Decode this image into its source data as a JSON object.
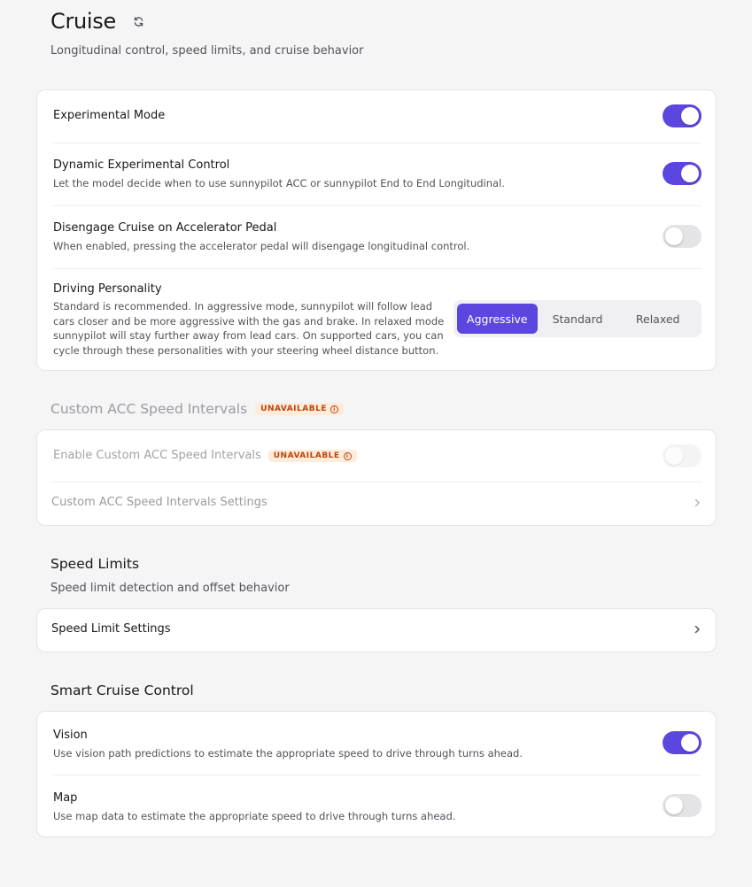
{
  "header": {
    "title": "Cruise",
    "subtitle": "Longitudinal control, speed limits, and cruise behavior"
  },
  "cruise": {
    "experimental": {
      "title": "Experimental Mode",
      "enabled": true
    },
    "dynamic": {
      "title": "Dynamic Experimental Control",
      "desc": "Let the model decide when to use sunnypilot ACC or sunnypilot End to End Longitudinal.",
      "enabled": true
    },
    "disengage": {
      "title": "Disengage Cruise on Accelerator Pedal",
      "desc": "When enabled, pressing the accelerator pedal will disengage longitudinal control.",
      "enabled": false
    },
    "personality": {
      "title": "Driving Personality",
      "desc": "Standard is recommended. In aggressive mode, sunnypilot will follow lead cars closer and be more aggressive with the gas and brake. In relaxed mode sunnypilot will stay further away from lead cars. On supported cars, you can cycle through these personalities with your steering wheel distance button.",
      "options": [
        "Aggressive",
        "Standard",
        "Relaxed"
      ],
      "selected": "Aggressive"
    }
  },
  "custom_acc": {
    "title": "Custom ACC Speed Intervals",
    "badge": "UNAVAILABLE",
    "enable": {
      "title": "Enable Custom ACC Speed Intervals",
      "badge": "UNAVAILABLE",
      "enabled": false
    },
    "settings_label": "Custom ACC Speed Intervals Settings"
  },
  "speed_limits": {
    "title": "Speed Limits",
    "subtitle": "Speed limit detection and offset behavior",
    "settings_label": "Speed Limit Settings"
  },
  "smart_cruise": {
    "title": "Smart Cruise Control",
    "vision": {
      "title": "Vision",
      "desc": "Use vision path predictions to estimate the appropriate speed to drive through turns ahead.",
      "enabled": true
    },
    "map": {
      "title": "Map",
      "desc": "Use map data to estimate the appropriate speed to drive through turns ahead.",
      "enabled": false
    }
  },
  "colors": {
    "accent": "#5b47e0",
    "badge_bg": "#fdecd9",
    "badge_text": "#c2410c",
    "background": "#f5f5f6"
  },
  "icons": {
    "refresh": "refresh-icon",
    "chevron": "chevron-right-icon",
    "info": "info-icon"
  }
}
